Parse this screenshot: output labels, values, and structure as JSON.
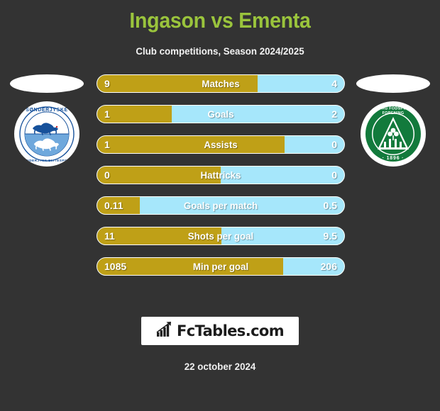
{
  "header": {
    "title": "Ingason vs Ementa",
    "subtitle": "Club competitions, Season 2024/2025"
  },
  "colors": {
    "background": "#333333",
    "title": "#9ac43c",
    "home_bar": "#bfa017",
    "away_bar": "#a6e7fb",
    "text": "#ffffff"
  },
  "clubs": {
    "home": {
      "name": "SØNDERJYSKE",
      "motto": "SØNDERJYSK ELITESPORT",
      "primary": "#16519b",
      "logo_icon": "sonderjyske-badge-icon"
    },
    "away": {
      "name": "VIBORG FODSPORTS FORENING",
      "year": "1896",
      "primary": "#127a3c",
      "logo_icon": "viborg-ff-badge-icon"
    }
  },
  "stats": [
    {
      "label": "Matches",
      "home": "9",
      "away": "4",
      "home_pct": 65.0
    },
    {
      "label": "Goals",
      "home": "1",
      "away": "2",
      "home_pct": 30.3
    },
    {
      "label": "Assists",
      "home": "1",
      "away": "0",
      "home_pct": 76.0
    },
    {
      "label": "Hattricks",
      "home": "0",
      "away": "0",
      "home_pct": 50.0
    },
    {
      "label": "Goals per match",
      "home": "0.11",
      "away": "0.5",
      "home_pct": 17.1
    },
    {
      "label": "Shots per goal",
      "home": "11",
      "away": "9.5",
      "home_pct": 50.3
    },
    {
      "label": "Min per goal",
      "home": "1085",
      "away": "206",
      "home_pct": 75.4
    }
  ],
  "footer": {
    "brand": "FcTables.com",
    "brand_icon": "bar-chart-growth-icon",
    "date": "22 october 2024"
  }
}
